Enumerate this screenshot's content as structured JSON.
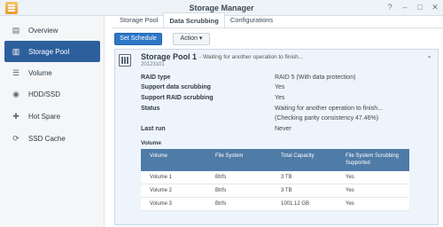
{
  "window": {
    "title": "Storage Manager",
    "controls": [
      "?",
      "–",
      "□",
      "✕"
    ]
  },
  "sidebar": {
    "items": [
      {
        "label": "Overview",
        "icon": "overview-icon",
        "glyph": "▤"
      },
      {
        "label": "Storage Pool",
        "icon": "storage-pool-icon",
        "glyph": "▥"
      },
      {
        "label": "Volume",
        "icon": "volume-icon",
        "glyph": "☰"
      },
      {
        "label": "HDD/SSD",
        "icon": "disk-icon",
        "glyph": "◉"
      },
      {
        "label": "Hot Spare",
        "icon": "hot-spare-icon",
        "glyph": "✚"
      },
      {
        "label": "SSD Cache",
        "icon": "ssd-cache-icon",
        "glyph": "⟳"
      }
    ]
  },
  "tabs": [
    "Storage Pool",
    "Data Scrubbing",
    "Configurations"
  ],
  "toolbar": {
    "set_schedule": "Set Schedule",
    "action": "Action ▾"
  },
  "pool": {
    "name": "Storage Pool 1",
    "status": "- Waiting for another operation to finish...",
    "id": "20123101",
    "collapse_glyph": "⌃",
    "rows": [
      {
        "label": "RAID type",
        "value": "RAID 5 (With data protection)"
      },
      {
        "label": "Support data scrubbing",
        "value": "Yes"
      },
      {
        "label": "Support RAID scrubbing",
        "value": "Yes"
      },
      {
        "label": "Status",
        "value": "Waiting for another operation to finish..."
      },
      {
        "label": "",
        "value": "(Checking parity consistency 47.46%)"
      },
      {
        "label": "Last run",
        "value": "Never"
      }
    ],
    "volume_heading": "Volume",
    "volume_table": {
      "headers": [
        "Volume",
        "File System",
        "Total Capacity",
        "File System Scrubbing Supported"
      ],
      "rows": [
        [
          "Volume 1",
          "Btrfs",
          "3 TB",
          "Yes"
        ],
        [
          "Volume 2",
          "Btrfs",
          "3 TB",
          "Yes"
        ],
        [
          "Volume 3",
          "Btrfs",
          "1001.12 GB",
          "Yes"
        ]
      ]
    }
  },
  "colors": {
    "accent": "#2e5f9d",
    "primary_button": "#2d77c8",
    "table_header": "#4f7ba7",
    "panel": "#eef4fb"
  }
}
